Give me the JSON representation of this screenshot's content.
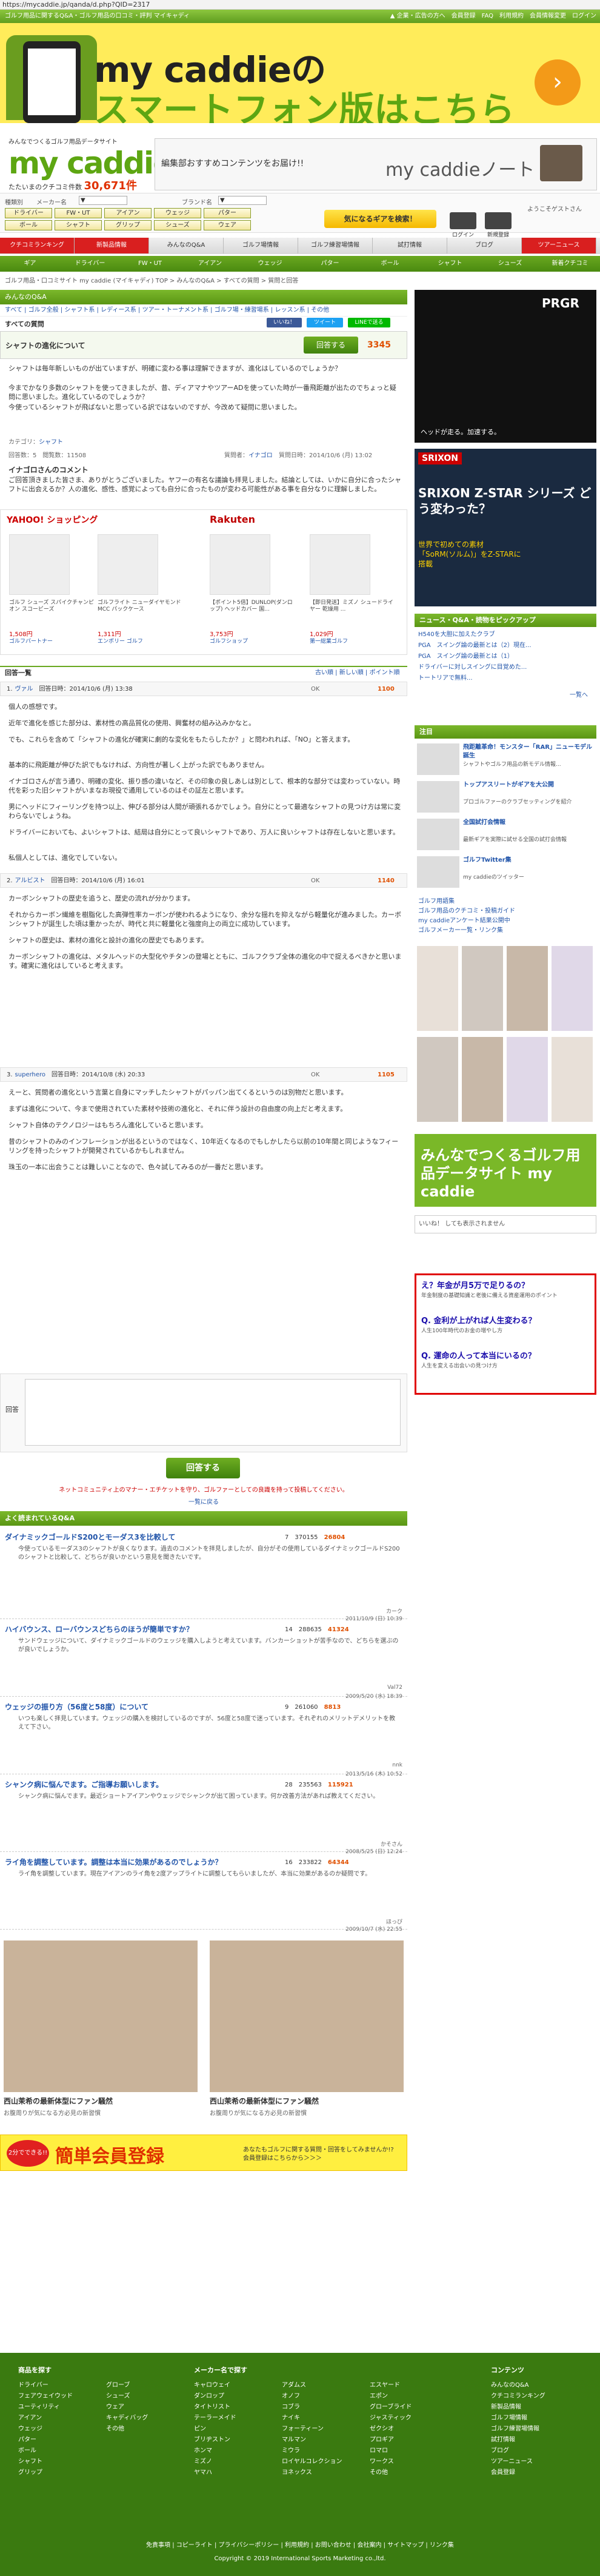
{
  "browser": {
    "url": "https://mycaddie.jp/qanda/d.php?QID=2317"
  },
  "topbar": {
    "tagline": "ゴルフ用品に関するQ&A・ゴルフ用品の口コミ・評判 マイキャディ",
    "links": [
      "▲ 企業・広告の方へ",
      "会員登録",
      "FAQ",
      "利用規約",
      "会員情報変更",
      "ログイン"
    ]
  },
  "banner": {
    "line1": "my caddieの",
    "line2": "スマートフォン版はこちら",
    "arrow": "›"
  },
  "logo": {
    "small": "みんなでつくるゴルフ用品データサイト",
    "big": "my caddie",
    "sub_prefix": "たたいまのクチコミ件数",
    "count": "30,671件"
  },
  "note_banner": {
    "text": "編集部おすすめコンテンツをお届け!!",
    "title": "my caddieノート"
  },
  "search": {
    "label_kind": "種類別",
    "label_maker": "メーカー名",
    "label_brand": "ブランド名",
    "select_default": "▼",
    "categories": [
      "ドライバー",
      "FW・UT",
      "アイアン",
      "ウェッジ",
      "パター",
      "ボール",
      "シャフト",
      "グリップ",
      "シューズ",
      "ウェア"
    ],
    "button": "気になるギアを検索！",
    "guest": "ようこそゲストさん",
    "login": "ログイン",
    "register": "新規登録"
  },
  "nav1": [
    {
      "label": "クチコミランキング",
      "red": true
    },
    {
      "label": "新製品情報",
      "red": true
    },
    {
      "label": "みんなのQ&A",
      "red": false
    },
    {
      "label": "ゴルフ場情報",
      "red": false
    },
    {
      "label": "ゴルフ練習場情報",
      "red": false
    },
    {
      "label": "試打情報",
      "red": false
    },
    {
      "label": "ブログ",
      "red": false
    },
    {
      "label": "ツアーニュース",
      "red": true
    }
  ],
  "nav2": [
    "ギア",
    "ドライバー",
    "FW・UT",
    "アイアン",
    "ウェッジ",
    "パター",
    "ボール",
    "シャフト",
    "シューズ",
    "新着クチコミ"
  ],
  "breadcrumb": "ゴルフ用品・口コミサイト my caddie (マイキャディ) TOP > みんなのQ&A > すべての質問 > 質問と回答",
  "qa_header": "みんなのQ&A",
  "subnav": "すべて | ゴルフ全般 | シャフト系 | レディース系 | ツアー・トーナメント系 | ゴルフ場・練習場系 | レッスン系 | その他",
  "qa_all": "すべての質問",
  "social": {
    "like": "いいね！",
    "tweet": "ツイート",
    "line": "LINEで送る"
  },
  "question": {
    "title": "シャフトの進化について",
    "answer_btn": "回答する",
    "points": "3345",
    "body": [
      "シャフトは毎年新しいものが出ていますが、明確に変わる事は理解できますが、進化はしているのでしょうか？",
      "今までかなり多数のシャフトを使ってきましたが、昔、ディアマナやツアーADを使っていた時が一番飛距離が出たのでちょっと疑問に思いました。進化しているのでしょうか？",
      "今使っているシャフトが飛ばないと思っている訳ではないのですが、今改めて疑問に思いました。"
    ],
    "category_label": "カテゴリ：",
    "category": "シャフト",
    "views": "回答数：5　閲覧数：11508",
    "asker_label": "質問者：",
    "asker": "イナゴロ",
    "date": "質問日時：2014/10/6 (月) 13:02",
    "comment_title": "イナゴロさんのコメント",
    "comment": "ご回答頂きました皆さま、ありがとうございました。ヤフーの有名な議論も拝見しました。結論としては、いかに自分に合ったシャフトに出会えるか？人の進化、感性、感覚によっても自分に合ったものが変わる可能性がある事を自分なりに理解しました。"
  },
  "ads": {
    "yahoo": "YAHOO! ショッピング",
    "rakuten": "Rakuten",
    "items": [
      {
        "name": "ゴルフ シューズ スパイクチャンピオン スコービーズ",
        "price": "1,508円",
        "shop": "ゴルフパートナー"
      },
      {
        "name": "ゴルフライト ニューダイヤモンド MCC パックケース",
        "price": "1,311円",
        "shop": "エンポリー ゴルフ"
      },
      {
        "name": "【ポイント5倍】DUNLOP(ダンロップ) ヘッドカバー 国...",
        "price": "3,753円",
        "shop": "ゴルフショップ"
      },
      {
        "name": "【即日発送】ミズノ シュードライヤー 乾燥用 ... ",
        "price": "1,029円",
        "shop": "第一総業ゴルフ"
      }
    ]
  },
  "answers_header": "回答一覧",
  "answers_nav": "古い順 | 新しい順 | ポイント順",
  "answers": [
    {
      "num": "1.",
      "user": "ヴァル",
      "date": "回答日時：2014/10/6 (月) 13:38",
      "ok": "OK",
      "points": "1100",
      "text": [
        "個人の感想です。",
        "近年で進化を感じた部分は、素材性の高品質化の使用、興奮材の組み込みかなと。",
        "でも、これらを含めて「シャフトの進化が確実に劇的な変化をもたらしたか？」と問われれば、「NO」と答えます。",
        "基本的に飛距離が伸びた訳でもなければ、方向性が著しく上がった訳でもありません。",
        "イナゴロさんが言う通り、明確の変化、振り感の違いなど、その印象の良しあしは別として、根本的な部分では変わっていない。時代を彩った旧シャフトがいまなお現役で通用しているのはその証左と思います。",
        "男にヘッドにフィーリングを持つ以上、伸びる部分は人間が頑張れるかでしょう。自分にとって最適なシャフトの見つけ方は常に変わらないでしょうね。",
        "ドライバーにおいても、よいシャフトは、結局は自分にとって良いシャフトであり、万人に良いシャフトは存在しないと思います。",
        "私個人としては、進化でしていない。"
      ]
    },
    {
      "num": "2.",
      "user": "アルビスト",
      "date": "回答日時：2014/10/6 (月) 16:01",
      "ok": "OK",
      "points": "1140",
      "text": [
        "カーボンシャフトの歴史を追うと、歴史の流れが分かります。",
        "それからカーボン繊維を樹脂化した高弾性率カーボンが使われるようになり、余分な揺れを抑えながら軽量化が進みました。カーボンシャフトが誕生した頃は重かったが、時代と共に軽量化と強度向上の両立に成功しています。",
        "シャフトの歴史は、素材の進化と設計の進化の歴史でもあります。",
        "カーボンシャフトの進化は、メタルヘッドの大型化やチタンの登場とともに、ゴルフクラブ全体の進化の中で捉えるべきかと思います。確実に進化はしていると考えます。"
      ]
    },
    {
      "num": "3.",
      "user": "superhero",
      "date": "回答日時：2014/10/8 (水) 20:33",
      "ok": "OK",
      "points": "1105",
      "text": [
        "えーと、質問者の進化という言葉と自身にマッチしたシャフトがパッパン出てくるというのは別物だと思います。",
        "まずは進化について、今まで使用されていた素材や技術の進化と、それに伴う設計の自由度の向上だと考えます。",
        "シャフト自体のテクノロジーはもちろん進化していると思います。",
        "昔のシャフトのみのインフレーションが出るというのではなく、10年近くなるのでもしかしたら以前の10年間と同じようなフィーリングを持ったシャフトが開発されているかもしれません。",
        "珠玉の一本に出会うことは難しいことなので、色々試してみるのが一番だと思います。"
      ]
    }
  ],
  "answer_form": {
    "label": "回答",
    "button": "回答する",
    "note": "ネットコミュニティ上のマナー・エチケットを守り、ゴルファーとしての良識を持って投稿してください。",
    "back": "一覧に戻る"
  },
  "popular_header": "よく読まれているQ&A",
  "popular": [
    {
      "title": "ダイナミックゴールドS200とモーダス3を比較して",
      "answers": "7",
      "views": "370155",
      "pts": "26804",
      "text": "今使っているモーダス3のシャフトが良くなります。過去のコメントを拝見しましたが、自分がその使用しているダイナミックゴールドS200のシャフトと比較して、どちらが良いかという意見を聞きたいです。",
      "author": "カーク",
      "date": "2011/10/9 (日) 10:39"
    },
    {
      "title": "ハイバウンス、ローバウンスどちらのほうが簡単ですか？",
      "answers": "14",
      "views": "288635",
      "pts": "41324",
      "text": "サンドウェッジについて、ダイナミックゴールドのウェッジを購入しようと考えています。バンカーショットが苦手なので、どちらを選ぶのが良いでしょうか。",
      "author": "Val72",
      "date": "2009/5/20 (水) 18:39"
    },
    {
      "title": "ウェッジの振り方（56度と58度）について",
      "answers": "9",
      "views": "261060",
      "pts": "8813",
      "text": "いつも楽しく拝見しています。ウェッジの購入を検討しているのですが、56度と58度で迷っています。それぞれのメリットデメリットを教えて下さい。",
      "author": "nnk",
      "date": "2013/5/16 (木) 10:52"
    },
    {
      "title": "シャンク病に悩んでます。ご指導お願いします。",
      "answers": "28",
      "views": "235563",
      "pts": "115921",
      "text": "シャンク病に悩んでます。最近ショートアイアンやウェッジでシャンクが出て困っています。何か改善方法があれば教えてください。",
      "author": "かそさん",
      "date": "2008/5/25 (日) 12:24"
    },
    {
      "title": "ライ角を調整しています。調整は本当に効果があるのでしょうか？",
      "answers": "16",
      "views": "233822",
      "pts": "64344",
      "text": "ライ角を調整しています。現在アイアンのライ角を2度アップライトに調整してもらいましたが、本当に効果があるのか疑問です。",
      "author": "ほっぴ",
      "date": "2009/10/7 (水) 22:55"
    }
  ],
  "register_banner": {
    "left": "2分でできる!!",
    "title": "簡単会員登録",
    "right": "あなたもゴルフに関する質問・回答をしてみませんか!? 会員登録はこちらから＞＞＞"
  },
  "sidebar": {
    "ad1": "PRGR",
    "ad1_sub": "ヘッドが走る。加速する。",
    "ad2": "SRIXON",
    "ad2_title": "SRIXON Z-STAR シリーズ どう変わった？",
    "ad3": "世界で初めての素材「SoRM(ソルム)」をZ-STARに搭載",
    "news_header": "ニュース・Q&A・読物をピックアップ",
    "news": [
      "H540を大胆に加えたクラブ",
      "PGA　スイング論の最新とは（2）現在...",
      "PGA　スイング論の最新とは（1）",
      "ドライバーに対しスイングに目覚めた...",
      "トートリアで無料..."
    ],
    "news_more": "一覧へ",
    "topics_header": "注目",
    "topics": [
      {
        "t": "飛距離革命！モンスター「RAR」ニューモデル誕生",
        "s": "シャフトやゴルフ用品の新モデル情報..."
      },
      {
        "t": "トップアスリートがギアを大公開",
        "s": "プロゴルファーのクラブセッティングを紹介"
      },
      {
        "t": "全国試打会情報",
        "s": "最新ギアを実際に試せる全国の試打会情報"
      },
      {
        "t": "ゴルフTwitter集",
        "s": "my caddieのツイッター"
      }
    ],
    "links": [
      "ゴルフ用語集",
      "ゴルフ用品のクチコミ・投稿ガイド",
      "my caddieアンケート結果公開中",
      "ゴルフメーカー一覧・リンク集"
    ],
    "mycaddie_banner": "みんなでつくるゴルフ用品データサイト my caddie",
    "facebook": "いいね！ しても表示されません",
    "ad_title1": "え？年金が月5万で足りるの？",
    "ad_text1": "年金制度の基礎知識と老後に備える資産運用のポイント",
    "ad_title2": "Q. 金利が上がれば人生変わる？",
    "ad_text2": "人生100年時代のお金の増やし方",
    "ad_title3": "Q. 運命の人って本当にいるの？",
    "ad_text3": "人生を変える出会いの見つけ方"
  },
  "bottom_ads": [
    {
      "title": "西山茉希の最新体型にファン騒然",
      "sub": "お腹周りが気になる方必見の新習慣"
    },
    {
      "title": "西山茉希の最新体型にファン騒然",
      "sub": "お腹周りが気になる方必見の新習慣"
    }
  ],
  "footer": {
    "col1_head": "商品を探す",
    "col1": [
      "ドライバー",
      "フェアウェイウッド",
      "ユーティリティ",
      "アイアン",
      "ウェッジ",
      "パター",
      "ボール",
      "シャフト",
      "グリップ"
    ],
    "col2": [
      "グローブ",
      "シューズ",
      "ウェア",
      "キャディバッグ",
      "その他"
    ],
    "col3_head": "メーカー名で探す",
    "col3": [
      "キャロウェイ",
      "ダンロップ",
      "タイトリスト",
      "テーラーメイド",
      "ピン",
      "ブリヂストン",
      "ホンマ",
      "ミズノ",
      "ヤマハ"
    ],
    "col4": [
      "アダムス",
      "オノフ",
      "コブラ",
      "ナイキ",
      "フォーティーン",
      "マルマン",
      "ミウラ",
      "ロイヤルコレクション",
      "ヨネックス"
    ],
    "col5": [
      "エスヤード",
      "エポン",
      "グローブライド",
      "ジャスティック",
      "ゼクシオ",
      "プロギア",
      "ロマロ",
      "ワークス",
      "その他"
    ],
    "col6_head": "コンテンツ",
    "col6": [
      "みんなのQ&A",
      "クチコミランキング",
      "新製品情報",
      "ゴルフ場情報",
      "ゴルフ練習場情報",
      "試打情報",
      "ブログ",
      "ツアーニュース",
      "会員登録"
    ],
    "links": "免責事項 | コピーライト | プライバシーポリシー | 利用規約 | お問い合わせ | 会社案内 | サイトマップ | リンク集",
    "copyright": "Copyright © 2019 International Sports Marketing co.,ltd."
  }
}
